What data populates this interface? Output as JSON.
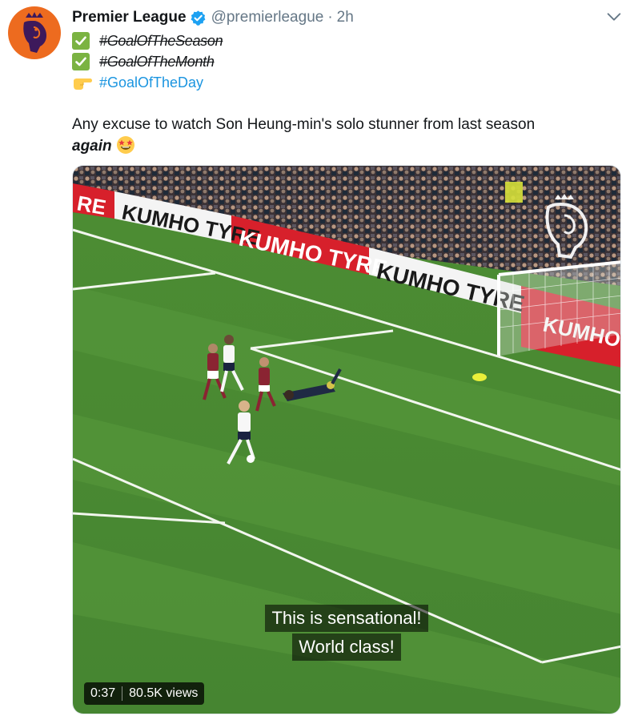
{
  "tweet": {
    "name": "Premier League",
    "handle": "@premierleague",
    "separator": "·",
    "time": "2h",
    "lines": [
      {
        "icon": "check-box-icon",
        "text": "#GoalOfTheSeason",
        "style": "strikethrough"
      },
      {
        "icon": "check-box-icon",
        "text": "#GoalOfTheMonth",
        "style": "strikethrough"
      },
      {
        "icon": "pointing-hand-icon",
        "text": "#GoalOfTheDay",
        "style": "hashtag-link"
      }
    ],
    "body_text": "Any excuse to watch Son Heung-min's solo stunner from last season",
    "body_emphasis": "again",
    "body_emoji": "star-struck-emoji"
  },
  "video": {
    "subtitle_lines": [
      "This is sensational!",
      "World class!"
    ],
    "duration": "0:37",
    "views": "80.5K views",
    "ad_boards": [
      "RE",
      "KUMHO TYRE",
      "KUMHO TYRE",
      "KUMHO TYRE",
      "KUMHO"
    ]
  },
  "colors": {
    "avatar_bg": "#ed6b1f",
    "link": "#1b95e0",
    "verified": "#1da1f2",
    "check": "#7bb342",
    "pitch": "#4f8f34",
    "board_red": "#d7202b"
  }
}
